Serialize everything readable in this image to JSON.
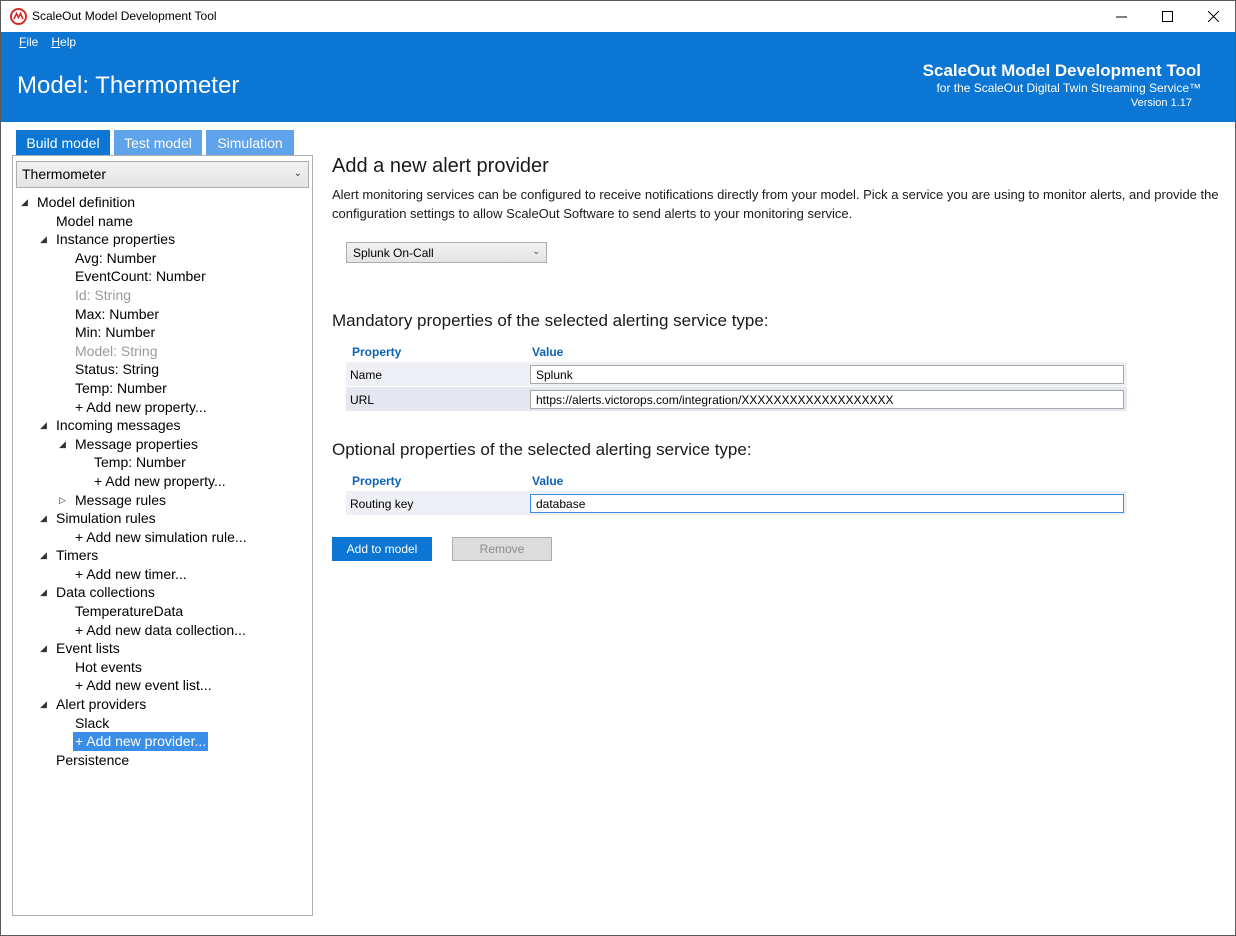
{
  "window": {
    "title": "ScaleOut Model Development Tool"
  },
  "menu": {
    "file": "File",
    "help": "Help"
  },
  "header": {
    "model_title": "Model: Thermometer",
    "brand_name": "ScaleOut Model Development Tool",
    "brand_sub": "for the ScaleOut Digital Twin Streaming Service™",
    "version": "Version 1.17",
    "accent_color": "#0b76d3"
  },
  "tabs": [
    {
      "label": "Build model",
      "active": true
    },
    {
      "label": "Test model",
      "active": false
    },
    {
      "label": "Simulation",
      "active": false
    }
  ],
  "sidebar": {
    "model_select": "Thermometer",
    "tree": [
      {
        "label": "Model definition",
        "level": 0,
        "arrow": "expanded"
      },
      {
        "label": "Model name",
        "level": 1,
        "arrow": "none"
      },
      {
        "label": "Instance properties",
        "level": 1,
        "arrow": "expanded"
      },
      {
        "label": "Avg: Number",
        "level": 2,
        "arrow": "none"
      },
      {
        "label": "EventCount: Number",
        "level": 2,
        "arrow": "none"
      },
      {
        "label": "Id: String",
        "level": 2,
        "arrow": "none",
        "disabled": true
      },
      {
        "label": "Max: Number",
        "level": 2,
        "arrow": "none"
      },
      {
        "label": "Min: Number",
        "level": 2,
        "arrow": "none"
      },
      {
        "label": "Model: String",
        "level": 2,
        "arrow": "none",
        "disabled": true
      },
      {
        "label": "Status: String",
        "level": 2,
        "arrow": "none"
      },
      {
        "label": "Temp: Number",
        "level": 2,
        "arrow": "none"
      },
      {
        "label": "+ Add new property...",
        "level": 2,
        "arrow": "none"
      },
      {
        "label": "Incoming messages",
        "level": 1,
        "arrow": "expanded"
      },
      {
        "label": "Message properties",
        "level": 2,
        "arrow": "expanded"
      },
      {
        "label": "Temp: Number",
        "level": 3,
        "arrow": "none"
      },
      {
        "label": "+ Add new property...",
        "level": 3,
        "arrow": "none"
      },
      {
        "label": "Message rules",
        "level": 2,
        "arrow": "collapsed"
      },
      {
        "label": "Simulation rules",
        "level": 1,
        "arrow": "expanded"
      },
      {
        "label": "+ Add new simulation rule...",
        "level": 2,
        "arrow": "none"
      },
      {
        "label": "Timers",
        "level": 1,
        "arrow": "expanded"
      },
      {
        "label": "+ Add new timer...",
        "level": 2,
        "arrow": "none"
      },
      {
        "label": "Data collections",
        "level": 1,
        "arrow": "expanded"
      },
      {
        "label": "TemperatureData",
        "level": 2,
        "arrow": "none"
      },
      {
        "label": "+ Add new data collection...",
        "level": 2,
        "arrow": "none"
      },
      {
        "label": "Event lists",
        "level": 1,
        "arrow": "expanded"
      },
      {
        "label": "Hot events",
        "level": 2,
        "arrow": "none"
      },
      {
        "label": "+ Add new event list...",
        "level": 2,
        "arrow": "none"
      },
      {
        "label": "Alert providers",
        "level": 1,
        "arrow": "expanded"
      },
      {
        "label": "Slack",
        "level": 2,
        "arrow": "none"
      },
      {
        "label": "+ Add new provider...",
        "level": 2,
        "arrow": "none",
        "selected": true
      },
      {
        "label": "Persistence",
        "level": 1,
        "arrow": "none"
      }
    ]
  },
  "main": {
    "title": "Add a new alert provider",
    "description": "Alert monitoring services can be configured to receive notifications directly from your model. Pick a service you are using to monitor alerts, and provide the configuration settings to allow ScaleOut Software to send alerts to your monitoring service.",
    "provider_select": "Splunk On-Call",
    "mandatory": {
      "heading": "Mandatory properties of the selected alerting service type:",
      "col_property": "Property",
      "col_value": "Value",
      "rows": [
        {
          "label": "Name",
          "value": "Splunk"
        },
        {
          "label": "URL",
          "value": "https://alerts.victorops.com/integration/XXXXXXXXXXXXXXXXXXX"
        }
      ]
    },
    "optional": {
      "heading": "Optional properties of the selected alerting service type:",
      "col_property": "Property",
      "col_value": "Value",
      "rows": [
        {
          "label": "Routing key",
          "value": "database"
        }
      ]
    },
    "add_button": "Add to model",
    "remove_button": "Remove"
  }
}
